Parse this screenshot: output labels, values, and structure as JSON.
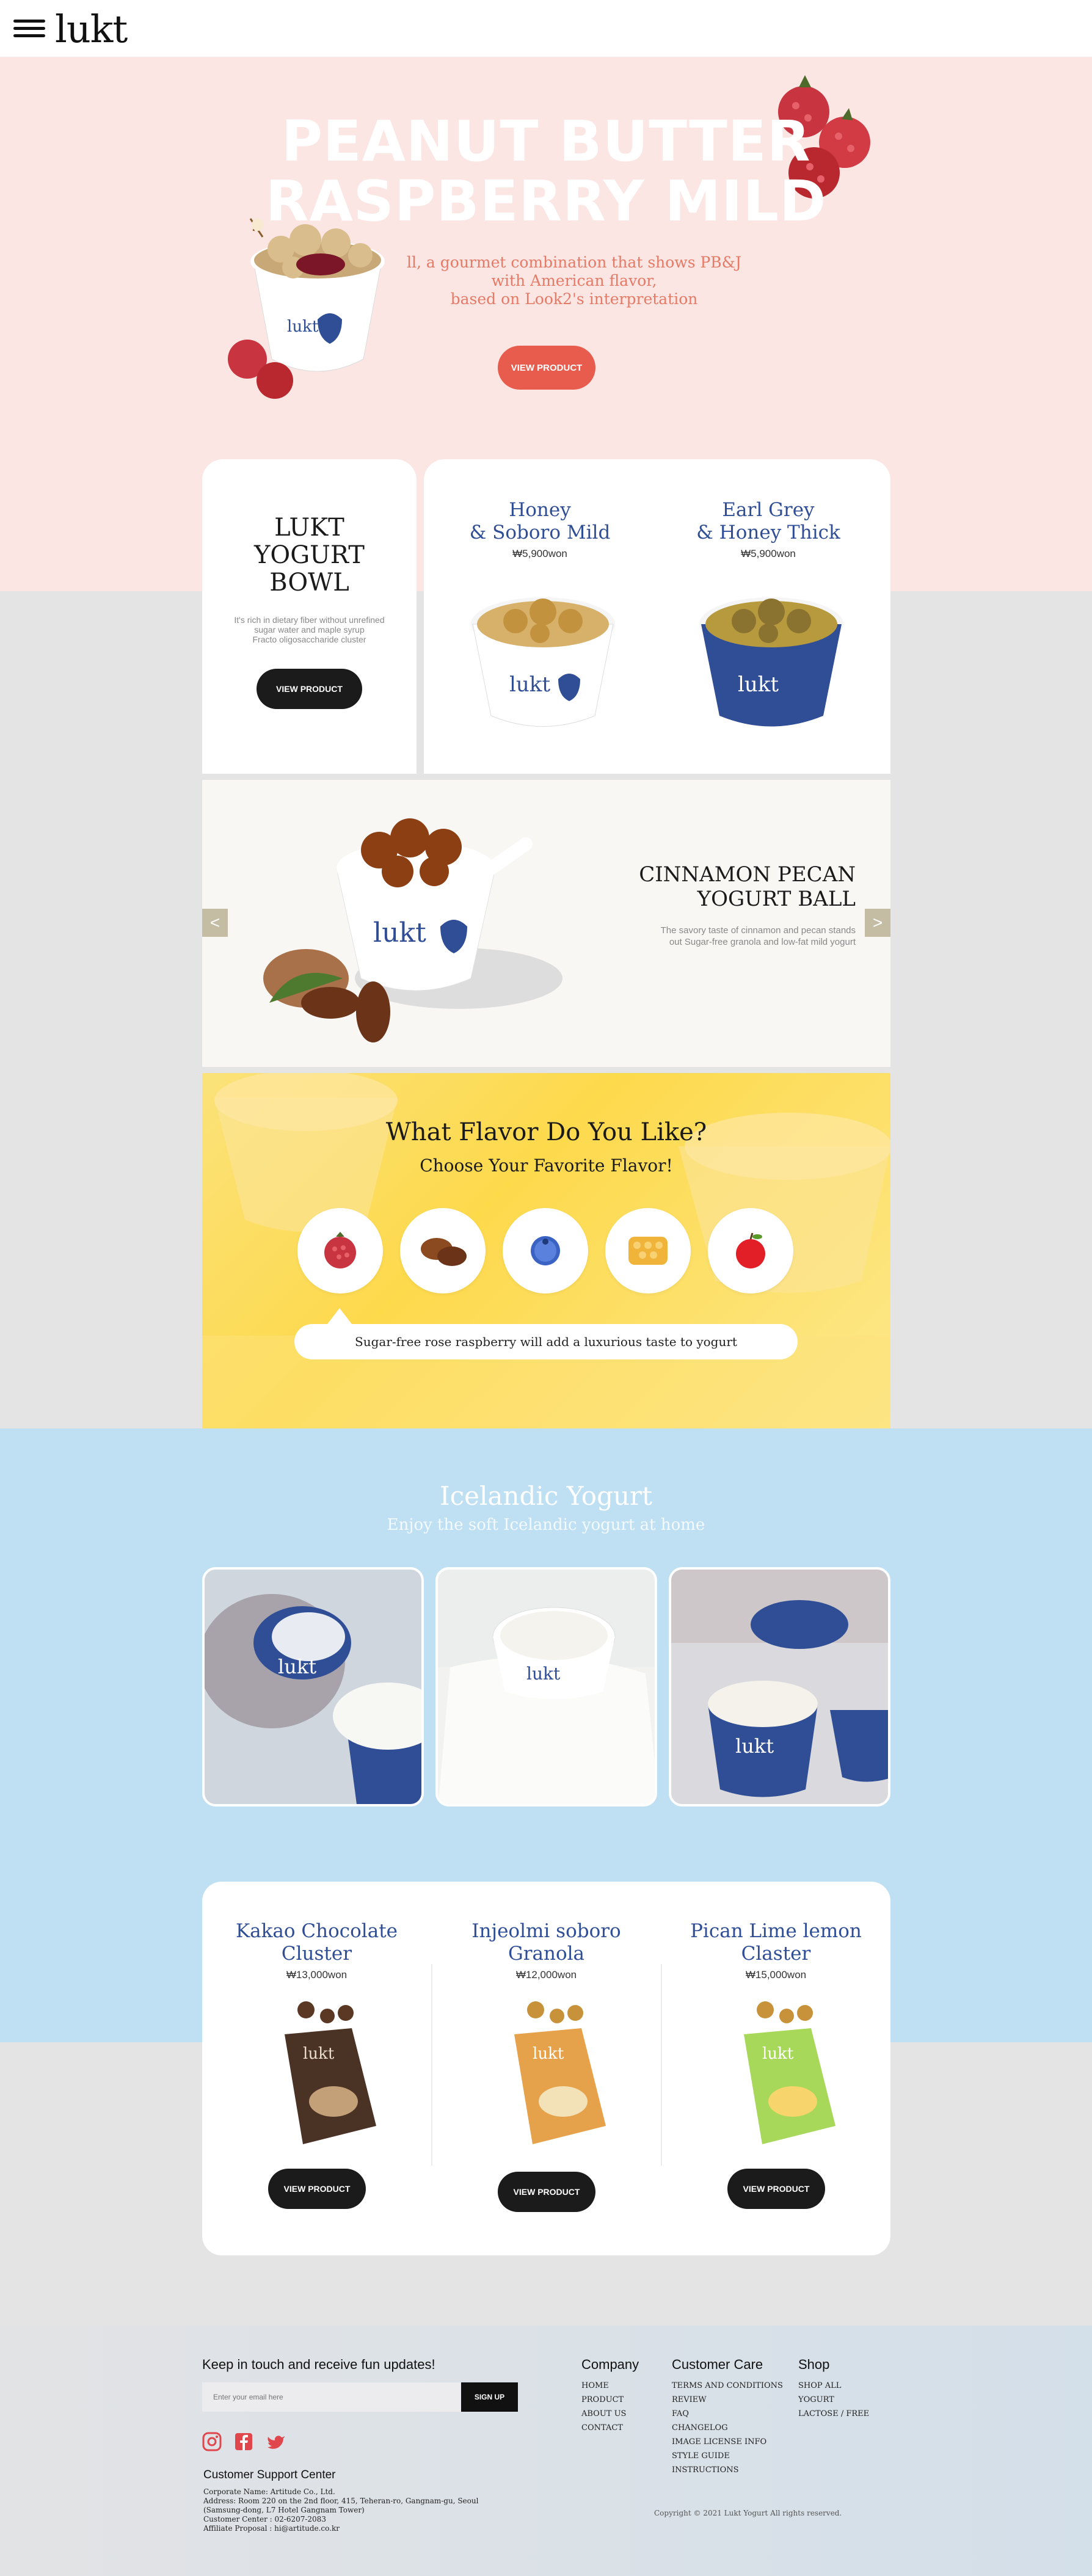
{
  "header": {
    "logo": "lukt"
  },
  "hero": {
    "title_line1": "PEANUT BUTTER",
    "title_line2": "RASPBERRY MILD",
    "desc_line1": "ll, a gourmet combination that shows PB&J",
    "desc_line2": "with American flavor,",
    "desc_line3": "based on Look2's interpretation",
    "button": "VIEW PRODUCT"
  },
  "bowl_card": {
    "title_line1": "LUKT",
    "title_line2": "YOGURT",
    "title_line3": "BOWL",
    "desc_line1": "It's rich in dietary fiber without unrefined",
    "desc_line2": "sugar water and maple syrup",
    "desc_line3": "Fracto oligosaccharide cluster",
    "button": "VIEW PRODUCT"
  },
  "bowl_products": [
    {
      "name_line1": "Honey",
      "name_line2": "& Soboro Mild",
      "price": "₩5,900won"
    },
    {
      "name_line1": "Earl Grey",
      "name_line2": "& Honey Thick",
      "price": "₩5,900won"
    }
  ],
  "slide": {
    "title_line1": "CINNAMON PECAN",
    "title_line2": "YOGURT BALL",
    "desc_line1": "The savory taste of cinnamon and pecan stands",
    "desc_line2": "out Sugar-free granola and low-fat mild yogurt",
    "prev": "<",
    "next": ">"
  },
  "flavor": {
    "title": "What Flavor Do You Like?",
    "subtitle": "Choose Your Favorite Flavor!",
    "items": [
      "raspberry-icon",
      "pecan-icon",
      "blueberry-icon",
      "honeycomb-icon",
      "apple-icon"
    ],
    "caption": "Sugar-free rose raspberry will add a luxurious taste to yogurt"
  },
  "icelandic": {
    "title": "Icelandic Yogurt",
    "subtitle": "Enjoy the soft Icelandic yogurt at home"
  },
  "granola": [
    {
      "name_line1": "Kakao Chocolate",
      "name_line2": "Cluster",
      "price": "₩13,000won",
      "button": "VIEW PRODUCT"
    },
    {
      "name_line1": "Injeolmi soboro",
      "name_line2": "Granola",
      "price": "₩12,000won",
      "button": "VIEW PRODUCT"
    },
    {
      "name_line1": "Pican Lime lemon",
      "name_line2": "Claster",
      "price": "₩15,000won",
      "button": "VIEW PRODUCT"
    }
  ],
  "footer": {
    "newsletter_title": "Keep in touch and receive fun updates!",
    "email_placeholder": "Enter your email here",
    "signup": "SIGN UP",
    "support_title": "Customer Support Center",
    "info": [
      "Corporate Name: Artitude Co., Ltd.",
      "Address: Room 220 on the 2nd floor, 415, Teheran-ro, Gangnam-gu, Seoul",
      "(Samsung-dong, L7 Hotel Gangnam Tower)",
      "Customer Center : 02-6207-2083",
      "Affiliate Proposal : hi@artitude.co.kr"
    ],
    "company": {
      "title": "Company",
      "links": [
        "HOME",
        "PRODUCT",
        "ABOUT US",
        "CONTACT"
      ]
    },
    "care": {
      "title": "Customer Care",
      "links": [
        "TERMS AND CONDITIONS",
        "REVIEW",
        "FAQ",
        "CHANGELOG",
        "IMAGE LICENSE INFO",
        "STYLE GUIDE",
        "INSTRUCTIONS"
      ]
    },
    "shop": {
      "title": "Shop",
      "links": [
        "SHOP ALL",
        "YOGURT",
        "LACTOSE / FREE"
      ]
    },
    "copyright": "Copyright © 2021 Lukt Yogurt All rights reserved."
  },
  "colors": {
    "hero_bg": "#fbe6e3",
    "accent_red": "#e75c4c",
    "product_blue": "#2f4e96",
    "ice_bg": "#bfe0f3"
  }
}
